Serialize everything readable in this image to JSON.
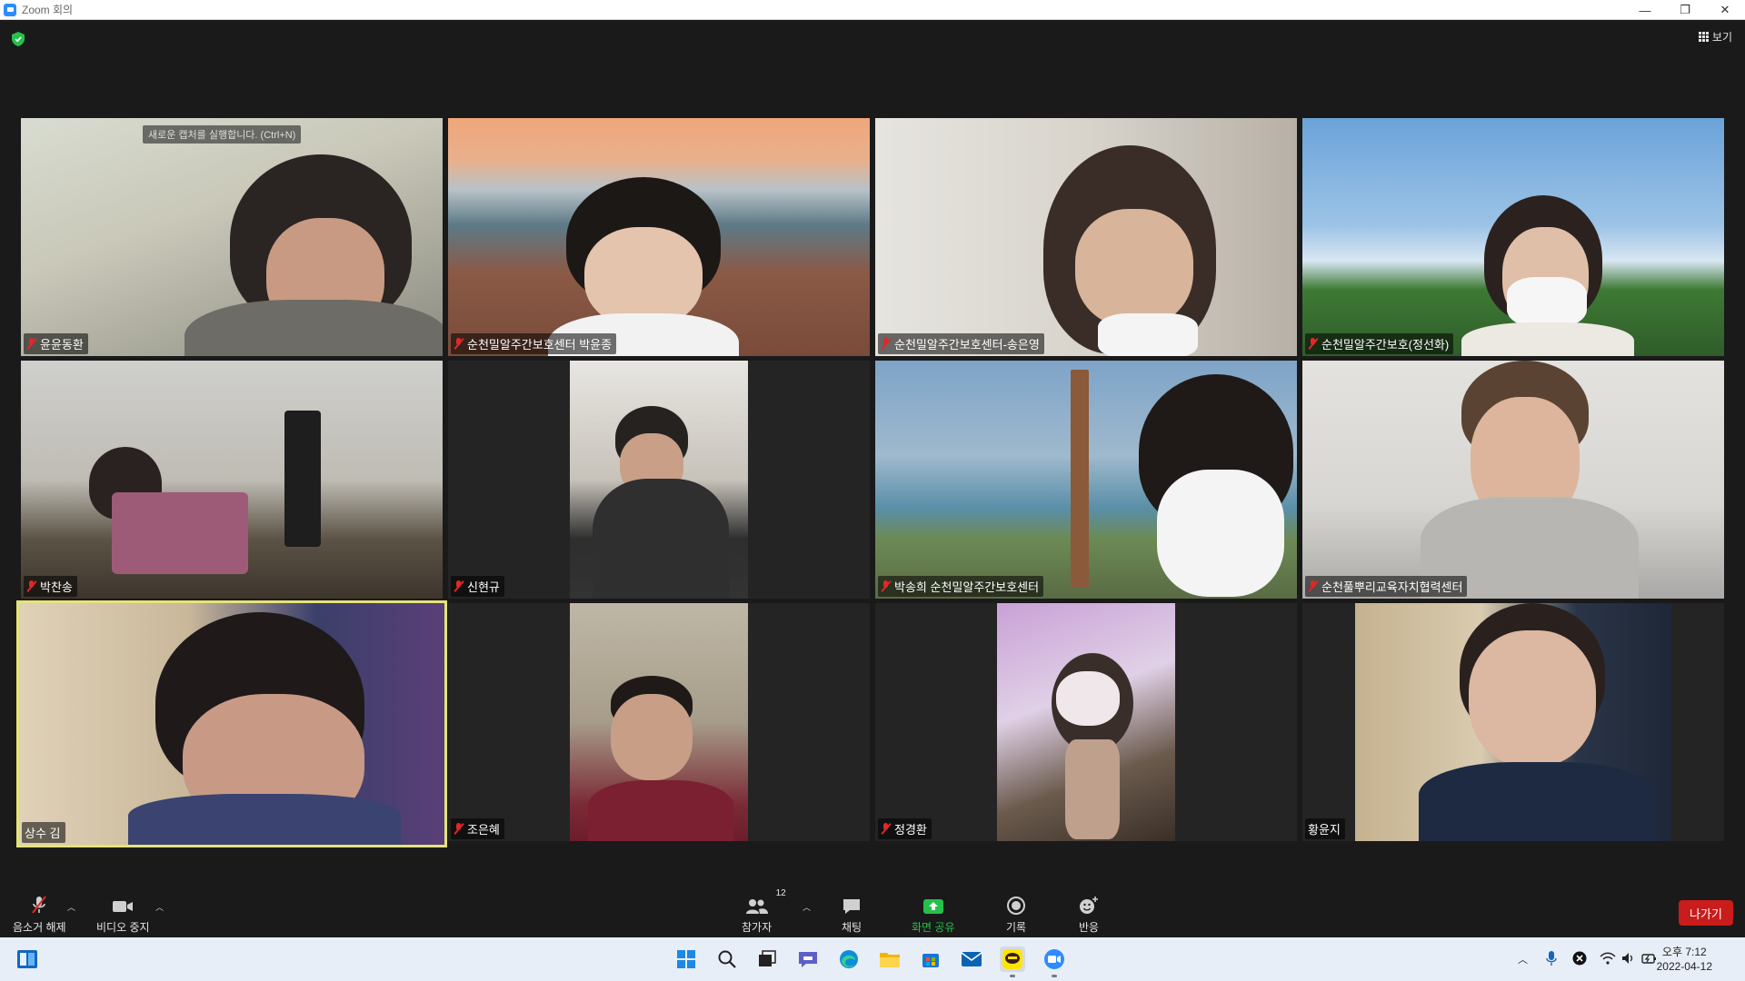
{
  "window": {
    "title": "Zoom 회의",
    "controls": [
      "—",
      "❐",
      "✕"
    ]
  },
  "meeting": {
    "view_label": "보기",
    "tooltip": "새로운 캡처를 실행합니다. (Ctrl+N)",
    "participants": [
      {
        "name": "윤윤동환",
        "muted": true
      },
      {
        "name": "순천밀알주간보호센터 박윤종",
        "muted": true
      },
      {
        "name": "순천밀알주간보호센터-송은영",
        "muted": true
      },
      {
        "name": "순천밀알주간보호(정선화)",
        "muted": true
      },
      {
        "name": "박찬송",
        "muted": true
      },
      {
        "name": "신현규",
        "muted": true
      },
      {
        "name": "박송희 순천밀알주간보호센터",
        "muted": true
      },
      {
        "name": "순천풀뿌리교육자치협력센터",
        "muted": true
      },
      {
        "name": "상수 김",
        "muted": false,
        "active_speaker": true
      },
      {
        "name": "조은혜",
        "muted": true
      },
      {
        "name": "정경환",
        "muted": true
      },
      {
        "name": "황윤지",
        "muted": false
      }
    ]
  },
  "toolbar": {
    "unmute_label": "음소거 해제",
    "stop_video_label": "비디오 중지",
    "participants_label": "참가자",
    "participants_count": "12",
    "chat_label": "채팅",
    "share_screen_label": "화면 공유",
    "record_label": "기록",
    "reactions_label": "반응",
    "leave_label": "나가기"
  },
  "taskbar": {
    "clock_ampm_time": "오후 7:12",
    "clock_date": "2022-04-12",
    "apps": [
      "start",
      "search",
      "task-view",
      "teams-chat",
      "edge",
      "file-explorer",
      "store",
      "mail",
      "kakaotalk",
      "zoom"
    ]
  },
  "colors": {
    "accent_active_speaker": "#e4e37a",
    "share_green": "#25c04b",
    "leave_red": "#c91c1c",
    "mute_red": "#e02828"
  }
}
